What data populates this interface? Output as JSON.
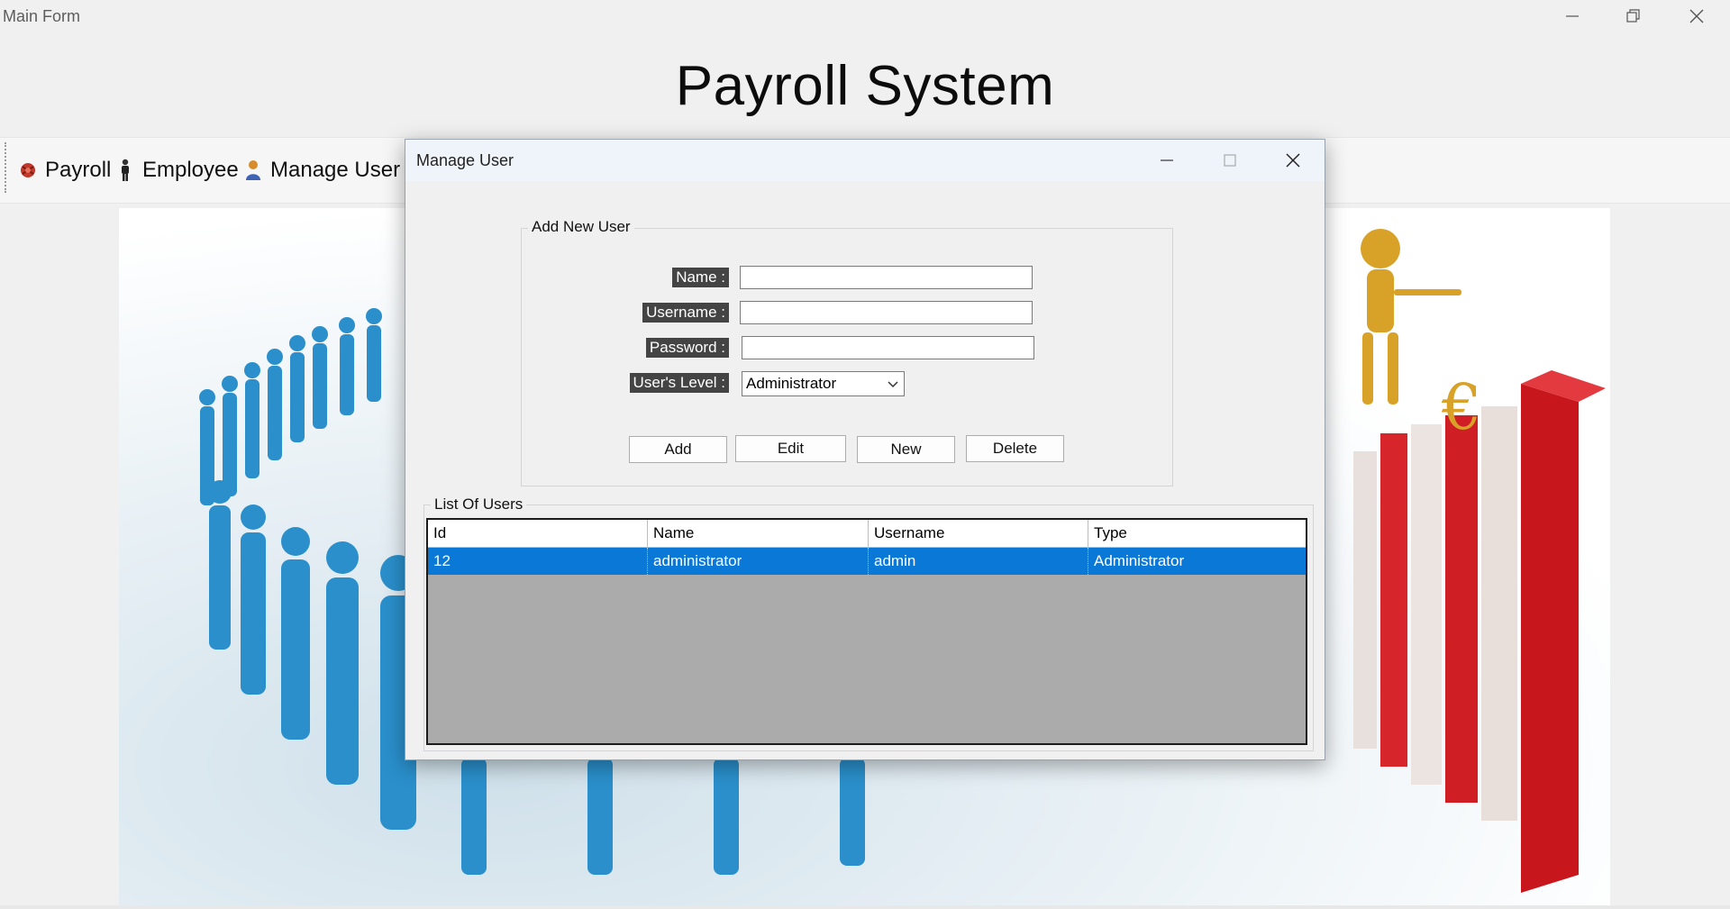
{
  "window": {
    "title": "Main Form",
    "minimize_icon": "minimize-icon",
    "restore_icon": "restore-icon",
    "close_icon": "close-icon"
  },
  "header": {
    "title": "Payroll System"
  },
  "menu": {
    "items": [
      {
        "label": "Payroll",
        "icon": "payroll-icon"
      },
      {
        "label": "Employee",
        "icon": "employee-icon"
      },
      {
        "label": "Manage User",
        "icon": "user-icon"
      }
    ]
  },
  "dialog": {
    "title": "Manage User",
    "add_group": {
      "legend": "Add New User",
      "name_label": "Name :",
      "name_value": "",
      "username_label": "Username :",
      "username_value": "",
      "password_label": "Password :",
      "password_value": "",
      "level_label": "User's Level :",
      "level_value": "Administrator",
      "buttons": {
        "add": "Add",
        "edit": "Edit",
        "new": "New",
        "delete": "Delete"
      }
    },
    "list_group": {
      "legend": "List Of Users",
      "columns": [
        "Id",
        "Name",
        "Username",
        "Type"
      ],
      "rows": [
        [
          "12",
          "administrator",
          "admin",
          "Administrator"
        ]
      ]
    }
  },
  "colors": {
    "selection": "#0a78d7",
    "grid_background": "#ababab",
    "label_background": "#444444"
  }
}
